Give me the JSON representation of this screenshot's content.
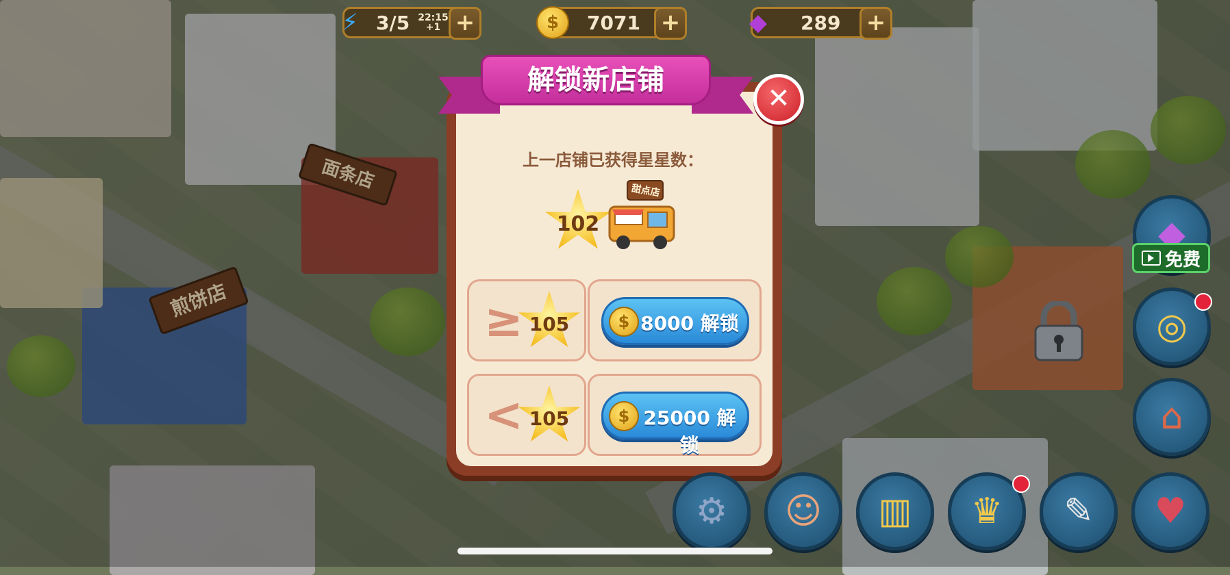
{
  "top_bar": {
    "energy": {
      "value": "3/5",
      "timer": "22:15",
      "timer_increment": "+1",
      "icon": "lightning-icon"
    },
    "coins": {
      "value": "7071",
      "icon": "coin-icon"
    },
    "gems": {
      "value": "289",
      "icon": "gem-icon"
    },
    "plus_label": "+"
  },
  "map_signs": {
    "noodle_shop": "面条店",
    "pancake_shop": "煎饼店",
    "food_truck": "甜点店"
  },
  "dialog": {
    "title": "解锁新店铺",
    "close_label": "✕",
    "subtitle": "上一店铺已获得星星数：",
    "earned_stars": "102",
    "options": [
      {
        "comparator": "≥",
        "stars": "105",
        "coin_symbol": "$",
        "button_label": "8000 解锁"
      },
      {
        "comparator": "<",
        "stars": "105",
        "coin_symbol": "$",
        "button_label": "25000 解锁"
      }
    ]
  },
  "side_menu": {
    "free_label": "免费",
    "items": [
      {
        "name": "gem-offer",
        "icon": "gem-icon"
      },
      {
        "name": "spin-wheel",
        "icon": "wheel-icon",
        "badge": true
      },
      {
        "name": "shop",
        "icon": "shop-icon"
      }
    ]
  },
  "bottom_menu": [
    {
      "name": "settings",
      "icon": "gear-icon"
    },
    {
      "name": "friends",
      "icon": "friends-icon"
    },
    {
      "name": "ranking",
      "icon": "podium-icon"
    },
    {
      "name": "trophy",
      "icon": "trophy-icon",
      "badge": true
    },
    {
      "name": "tasks",
      "icon": "notepad-icon"
    },
    {
      "name": "collection",
      "icon": "book-heart-icon"
    }
  ]
}
